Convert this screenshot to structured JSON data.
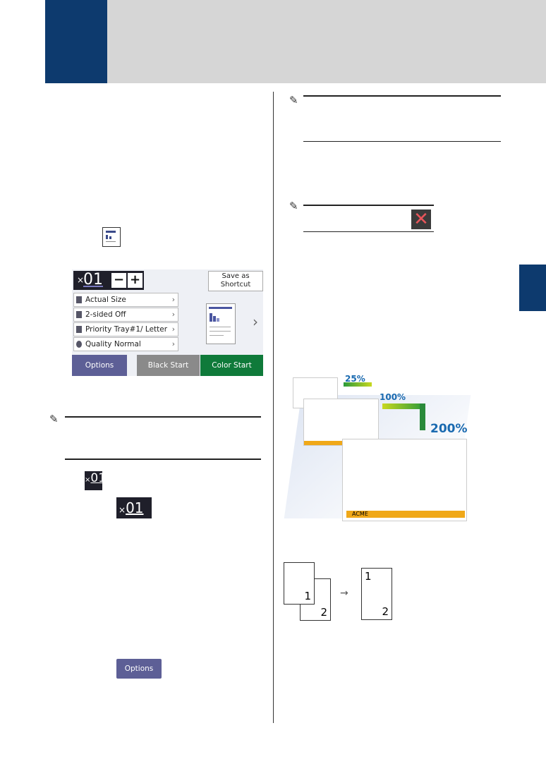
{
  "lcd": {
    "count_prefix": "×",
    "count": "01",
    "minus": "−",
    "plus": "+",
    "save_shortcut": "Save as Shortcut",
    "rows": [
      {
        "label": "Actual Size"
      },
      {
        "label": "2-sided Off"
      },
      {
        "label": "Priority Tray#1/ Letter"
      },
      {
        "label": "Quality Normal"
      }
    ],
    "options": "Options",
    "black_start": "Black Start",
    "color_start": "Color Start",
    "colors": {
      "options": "#5d5f96",
      "black_start": "#8a8a8a",
      "color_start": "#0f7a3a"
    }
  },
  "badges": [
    {
      "prefix": "×",
      "count": "01"
    },
    {
      "prefix": "×",
      "count": "01"
    }
  ],
  "options_button": "Options",
  "enlarge_figure": {
    "labels": [
      "25%",
      "100%",
      "200%"
    ],
    "brand": "ACME"
  },
  "duplex_figure": {
    "pages": [
      "1",
      "2"
    ],
    "result_pages": [
      "1",
      "2"
    ],
    "arrow": "→"
  },
  "colors": {
    "brand_blue": "#0d3a6e",
    "header_grey": "#d6d6d6"
  }
}
